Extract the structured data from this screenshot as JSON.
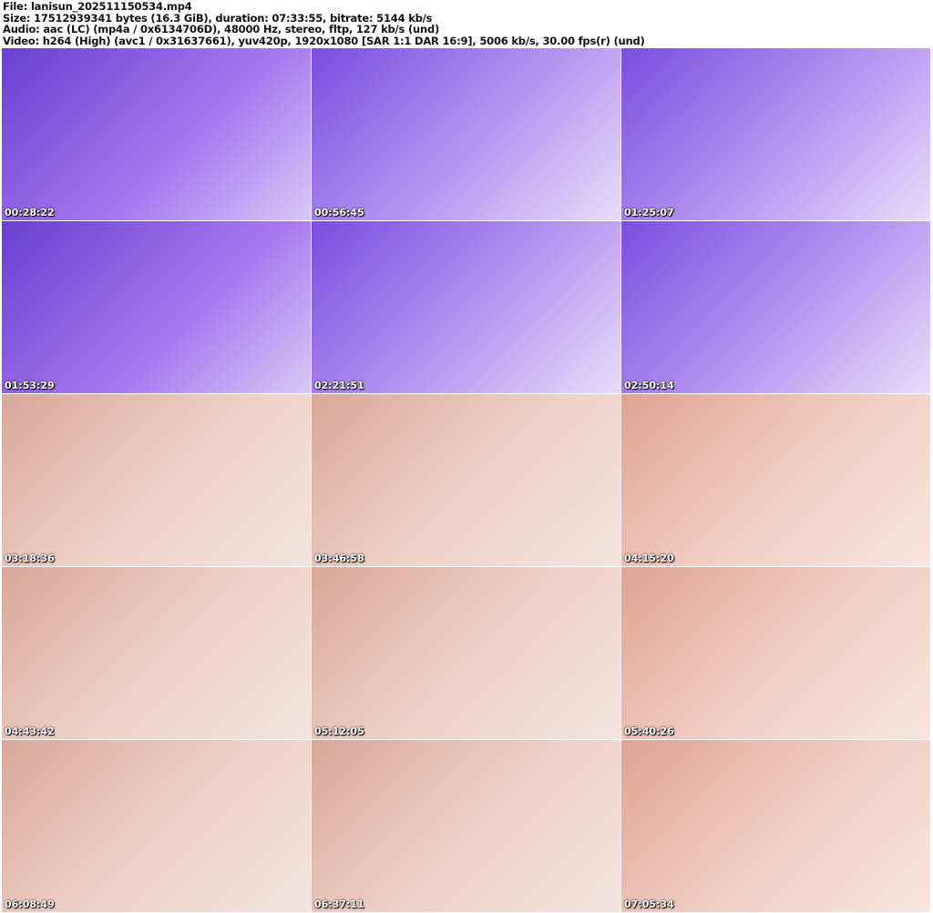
{
  "header": {
    "file": "File: lanisun_202511150534.mp4",
    "size": "Size: 17512939341 bytes (16.3 GiB), duration: 07:33:55, bitrate: 5144 kb/s",
    "audio": "Audio: aac (LC) (mp4a / 0x6134706D), 48000 Hz, stereo, fltp, 127 kb/s (und)",
    "video": "Video: h264 (High) (avc1 / 0x31637661), yuv420p, 1920x1080 [SAR 1:1 DAR 16:9], 5006 kb/s, 30.00 fps(r) (und)"
  },
  "thumbnails": [
    {
      "time": "00:28:22",
      "tone": "p1"
    },
    {
      "time": "00:56:45",
      "tone": "p2"
    },
    {
      "time": "01:25:07",
      "tone": "p2"
    },
    {
      "time": "01:53:29",
      "tone": "p1"
    },
    {
      "time": "02:21:51",
      "tone": "p2"
    },
    {
      "time": "02:50:14",
      "tone": "p2"
    },
    {
      "time": "03:18:36",
      "tone": "w1"
    },
    {
      "time": "03:46:58",
      "tone": "w1"
    },
    {
      "time": "04:15:20",
      "tone": "w2"
    },
    {
      "time": "04:43:42",
      "tone": "w1"
    },
    {
      "time": "05:12:05",
      "tone": "w1"
    },
    {
      "time": "05:40:26",
      "tone": "w2"
    },
    {
      "time": "06:08:49",
      "tone": "w1"
    },
    {
      "time": "06:37:11",
      "tone": "w1"
    },
    {
      "time": "07:05:34",
      "tone": "w2"
    }
  ]
}
